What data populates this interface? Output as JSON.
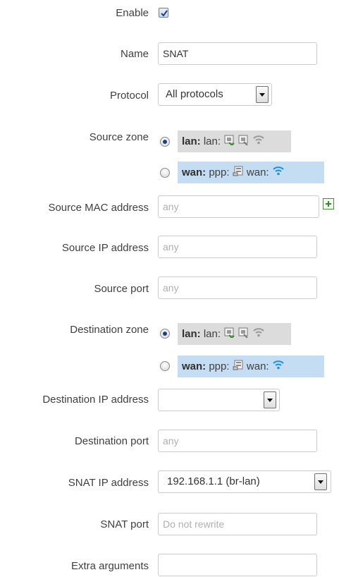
{
  "form": {
    "enable": {
      "label": "Enable",
      "checked": true
    },
    "name": {
      "label": "Name",
      "value": "SNAT"
    },
    "protocol": {
      "label": "Protocol",
      "value": "All protocols"
    },
    "source_zone": {
      "label": "Source zone",
      "options": [
        {
          "name": "lan:",
          "desc1": "lan:",
          "selected": true
        },
        {
          "name": "wan:",
          "desc1": "ppp:",
          "desc2": "wan:",
          "selected": false
        }
      ]
    },
    "source_mac": {
      "label": "Source MAC address",
      "placeholder": "any"
    },
    "source_ip": {
      "label": "Source IP address",
      "placeholder": "any"
    },
    "source_port": {
      "label": "Source port",
      "placeholder": "any"
    },
    "destination_zone": {
      "label": "Destination zone",
      "options": [
        {
          "name": "lan:",
          "desc1": "lan:",
          "selected": true
        },
        {
          "name": "wan:",
          "desc1": "ppp:",
          "desc2": "wan:",
          "selected": false
        }
      ]
    },
    "destination_ip": {
      "label": "Destination IP address",
      "value": ""
    },
    "destination_port": {
      "label": "Destination port",
      "placeholder": "any"
    },
    "snat_ip": {
      "label": "SNAT IP address",
      "value": "192.168.1.1 (br-lan)"
    },
    "snat_port": {
      "label": "SNAT port",
      "placeholder": "Do not rewrite"
    },
    "extra_arguments": {
      "label": "Extra arguments",
      "value": ""
    }
  },
  "colors": {
    "lan_zone_bg": "#dcdcdc",
    "wan_zone_bg": "#c4ddf2",
    "wifi_lan": "#9a9a9a",
    "wifi_wan": "#1e90e0"
  },
  "icons": [
    "checkbox-checked",
    "radio",
    "ethernet-port-icon",
    "wifi-icon",
    "ppp-modem-icon",
    "add-icon",
    "dropdown-arrow"
  ]
}
